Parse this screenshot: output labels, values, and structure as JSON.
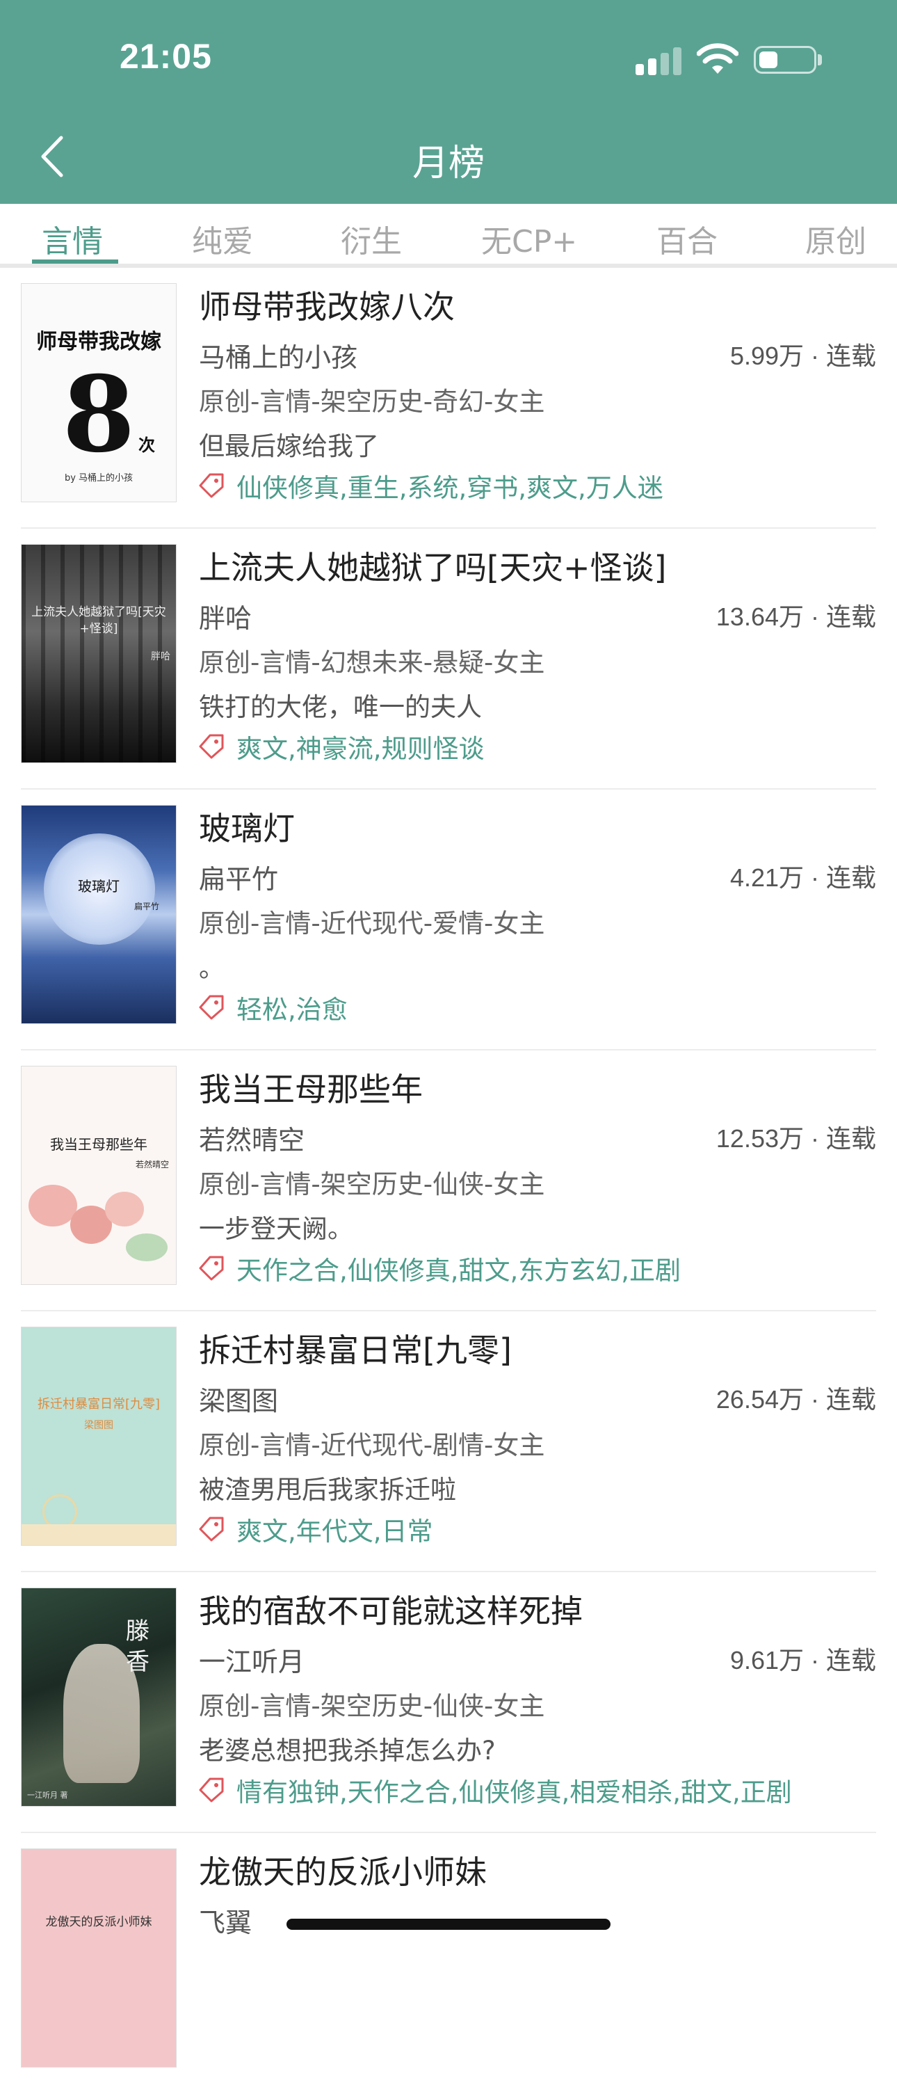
{
  "status": {
    "time": "21:05"
  },
  "header": {
    "title": "月榜"
  },
  "tabs": [
    {
      "label": "言情",
      "active": true
    },
    {
      "label": "纯爱",
      "active": false
    },
    {
      "label": "衍生",
      "active": false
    },
    {
      "label": "无CP+",
      "active": false
    },
    {
      "label": "百合",
      "active": false
    },
    {
      "label": "原创",
      "active": false
    }
  ],
  "books": [
    {
      "title": "师母带我改嫁八次",
      "author": "马桶上的小孩",
      "stats": "5.99万 · 连载",
      "genre": "原创-言情-架空历史-奇幻-女主",
      "blurb": "但最后嫁给我了",
      "tags": "仙侠修真,重生,系统,穿书,爽文,万人迷",
      "cover": {
        "title": "师母带我改嫁",
        "big": "8",
        "suffix": "次",
        "byline": "by 马桶上的小孩"
      }
    },
    {
      "title": "上流夫人她越狱了吗[天灾+怪谈]",
      "author": "胖哈",
      "stats": "13.64万 · 连载",
      "genre": "原创-言情-幻想未来-悬疑-女主",
      "blurb": "铁打的大佬，唯一的夫人",
      "tags": "爽文,神豪流,规则怪谈",
      "cover": {
        "title": "上流夫人她越狱了吗[天灾+怪谈]",
        "byline": "胖哈"
      }
    },
    {
      "title": "玻璃灯",
      "author": "扁平竹",
      "stats": "4.21万 · 连载",
      "genre": "原创-言情-近代现代-爱情-女主",
      "blurb": "。",
      "tags": "轻松,治愈",
      "cover": {
        "title": "玻璃灯",
        "byline": "扁平竹"
      }
    },
    {
      "title": "我当王母那些年",
      "author": "若然晴空",
      "stats": "12.53万 · 连载",
      "genre": "原创-言情-架空历史-仙侠-女主",
      "blurb": "一步登天阙。",
      "tags": "天作之合,仙侠修真,甜文,东方玄幻,正剧",
      "cover": {
        "title": "我当王母那些年",
        "byline": "若然晴空"
      }
    },
    {
      "title": "拆迁村暴富日常[九零]",
      "author": "梁图图",
      "stats": "26.54万 · 连载",
      "genre": "原创-言情-近代现代-剧情-女主",
      "blurb": "被渣男甩后我家拆迁啦",
      "tags": "爽文,年代文,日常",
      "cover": {
        "title": "拆迁村暴富日常[九零]",
        "byline": "梁图图"
      }
    },
    {
      "title": "我的宿敌不可能就这样死掉",
      "author": "一江听月",
      "stats": "9.61万 · 连载",
      "genre": "原创-言情-架空历史-仙侠-女主",
      "blurb": "老婆总想把我杀掉怎么办?",
      "tags": "情有独钟,天作之合,仙侠修真,相爱相杀,甜文,正剧",
      "cover": {
        "title": "滕香",
        "byline": "一江听月 著"
      }
    },
    {
      "title": "龙傲天的反派小师妹",
      "author": "飞翼",
      "stats": "",
      "genre": "",
      "blurb": "",
      "tags": "",
      "cover": {
        "title": "龙傲天的反派小师妹",
        "byline": ""
      }
    }
  ]
}
